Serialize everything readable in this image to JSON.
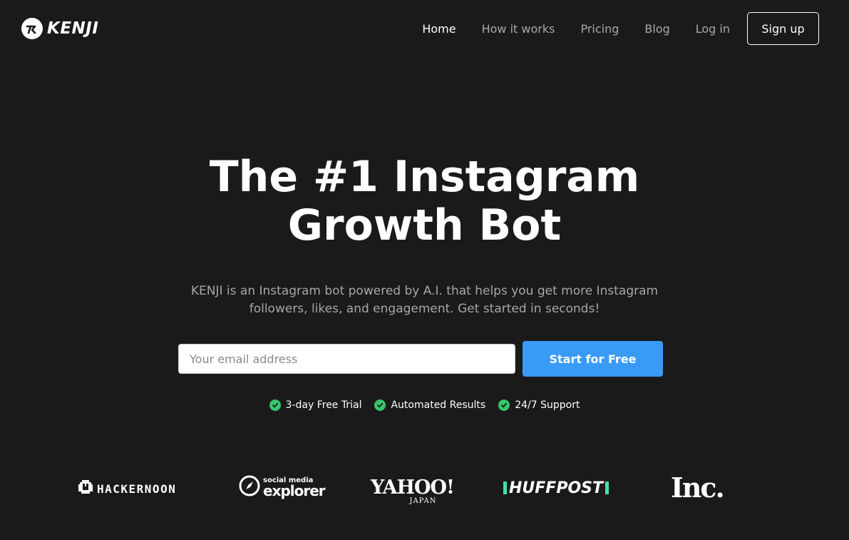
{
  "header": {
    "logo_text": "KENJI",
    "nav": [
      {
        "label": "Home",
        "active": true
      },
      {
        "label": "How it works",
        "active": false
      },
      {
        "label": "Pricing",
        "active": false
      },
      {
        "label": "Blog",
        "active": false
      },
      {
        "label": "Log in",
        "active": false
      }
    ],
    "signup_label": "Sign up"
  },
  "hero": {
    "title_line1": "The #1 Instagram",
    "title_line2": "Growth Bot",
    "subtitle_line1": "KENJI is an Instagram bot powered by A.I. that helps you get more Instagram",
    "subtitle_line2": "followers, likes, and engagement. Get started in seconds!",
    "email_placeholder": "Your email address",
    "cta_label": "Start for Free",
    "features": [
      "3-day Free Trial",
      "Automated Results",
      "24/7 Support"
    ]
  },
  "press": {
    "hackernoon": "HACKERNOON",
    "sme_small": "social media",
    "sme_big": "explorer",
    "yahoo_word": "YAHOO!",
    "yahoo_sub": "JAPAN",
    "huffpost": "HUFFPOST",
    "inc": "Inc."
  },
  "colors": {
    "background": "#1a1a1a",
    "accent_button": "#3a9bf7",
    "check_green": "#37c66b",
    "huffpost_bar": "#3fe0b0"
  },
  "icons": [
    "kenji-logo-icon",
    "check-circle-icon",
    "hackernoon-logo-icon",
    "compass-icon"
  ]
}
